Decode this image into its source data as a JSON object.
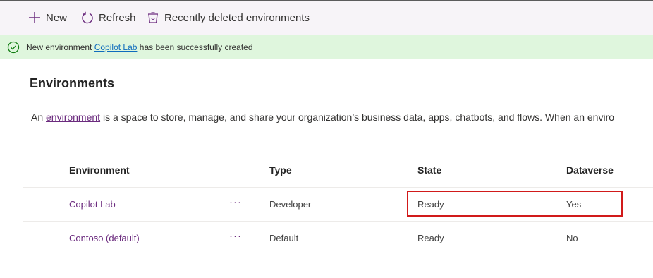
{
  "toolbar": {
    "new_label": "New",
    "refresh_label": "Refresh",
    "deleted_label": "Recently deleted environments"
  },
  "banner": {
    "prefix": "New environment ",
    "link": "Copilot Lab",
    "suffix": " has been successfully created",
    "icon": "check-circle-icon"
  },
  "page": {
    "title": "Environments",
    "desc_prefix": "An ",
    "desc_link": "environment",
    "desc_suffix": " is a space to store, manage, and share your organization’s business data, apps, chatbots, and flows. When an enviro"
  },
  "table": {
    "headers": [
      "Environment",
      "Type",
      "State",
      "Dataverse"
    ],
    "rows": [
      {
        "name": "Copilot Lab",
        "more": "···",
        "type": "Developer",
        "state": "Ready",
        "dataverse": "Yes"
      },
      {
        "name": "Contoso (default)",
        "more": "···",
        "type": "Default",
        "state": "Ready",
        "dataverse": "No"
      }
    ]
  },
  "colors": {
    "accent": "#6b2b7e",
    "banner_bg": "#dff6dd",
    "success": "#107c10",
    "highlight": "#d11a1a"
  }
}
